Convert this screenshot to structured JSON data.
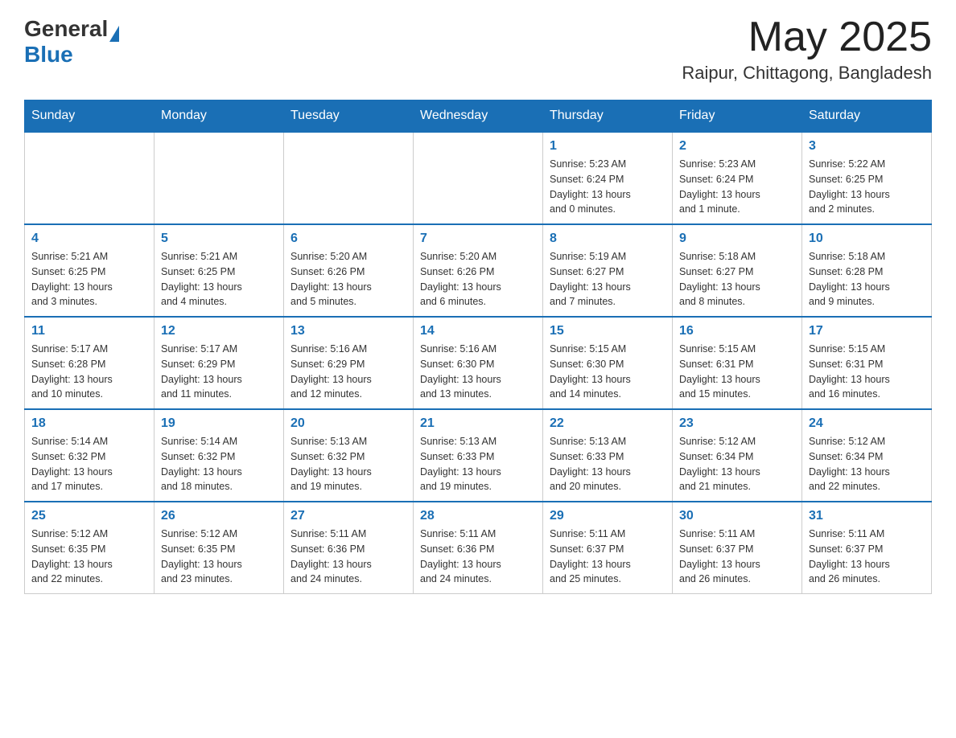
{
  "logo": {
    "general": "General",
    "blue": "Blue"
  },
  "title": "May 2025",
  "subtitle": "Raipur, Chittagong, Bangladesh",
  "days_of_week": [
    "Sunday",
    "Monday",
    "Tuesday",
    "Wednesday",
    "Thursday",
    "Friday",
    "Saturday"
  ],
  "weeks": [
    [
      {
        "day": "",
        "info": ""
      },
      {
        "day": "",
        "info": ""
      },
      {
        "day": "",
        "info": ""
      },
      {
        "day": "",
        "info": ""
      },
      {
        "day": "1",
        "info": "Sunrise: 5:23 AM\nSunset: 6:24 PM\nDaylight: 13 hours\nand 0 minutes."
      },
      {
        "day": "2",
        "info": "Sunrise: 5:23 AM\nSunset: 6:24 PM\nDaylight: 13 hours\nand 1 minute."
      },
      {
        "day": "3",
        "info": "Sunrise: 5:22 AM\nSunset: 6:25 PM\nDaylight: 13 hours\nand 2 minutes."
      }
    ],
    [
      {
        "day": "4",
        "info": "Sunrise: 5:21 AM\nSunset: 6:25 PM\nDaylight: 13 hours\nand 3 minutes."
      },
      {
        "day": "5",
        "info": "Sunrise: 5:21 AM\nSunset: 6:25 PM\nDaylight: 13 hours\nand 4 minutes."
      },
      {
        "day": "6",
        "info": "Sunrise: 5:20 AM\nSunset: 6:26 PM\nDaylight: 13 hours\nand 5 minutes."
      },
      {
        "day": "7",
        "info": "Sunrise: 5:20 AM\nSunset: 6:26 PM\nDaylight: 13 hours\nand 6 minutes."
      },
      {
        "day": "8",
        "info": "Sunrise: 5:19 AM\nSunset: 6:27 PM\nDaylight: 13 hours\nand 7 minutes."
      },
      {
        "day": "9",
        "info": "Sunrise: 5:18 AM\nSunset: 6:27 PM\nDaylight: 13 hours\nand 8 minutes."
      },
      {
        "day": "10",
        "info": "Sunrise: 5:18 AM\nSunset: 6:28 PM\nDaylight: 13 hours\nand 9 minutes."
      }
    ],
    [
      {
        "day": "11",
        "info": "Sunrise: 5:17 AM\nSunset: 6:28 PM\nDaylight: 13 hours\nand 10 minutes."
      },
      {
        "day": "12",
        "info": "Sunrise: 5:17 AM\nSunset: 6:29 PM\nDaylight: 13 hours\nand 11 minutes."
      },
      {
        "day": "13",
        "info": "Sunrise: 5:16 AM\nSunset: 6:29 PM\nDaylight: 13 hours\nand 12 minutes."
      },
      {
        "day": "14",
        "info": "Sunrise: 5:16 AM\nSunset: 6:30 PM\nDaylight: 13 hours\nand 13 minutes."
      },
      {
        "day": "15",
        "info": "Sunrise: 5:15 AM\nSunset: 6:30 PM\nDaylight: 13 hours\nand 14 minutes."
      },
      {
        "day": "16",
        "info": "Sunrise: 5:15 AM\nSunset: 6:31 PM\nDaylight: 13 hours\nand 15 minutes."
      },
      {
        "day": "17",
        "info": "Sunrise: 5:15 AM\nSunset: 6:31 PM\nDaylight: 13 hours\nand 16 minutes."
      }
    ],
    [
      {
        "day": "18",
        "info": "Sunrise: 5:14 AM\nSunset: 6:32 PM\nDaylight: 13 hours\nand 17 minutes."
      },
      {
        "day": "19",
        "info": "Sunrise: 5:14 AM\nSunset: 6:32 PM\nDaylight: 13 hours\nand 18 minutes."
      },
      {
        "day": "20",
        "info": "Sunrise: 5:13 AM\nSunset: 6:32 PM\nDaylight: 13 hours\nand 19 minutes."
      },
      {
        "day": "21",
        "info": "Sunrise: 5:13 AM\nSunset: 6:33 PM\nDaylight: 13 hours\nand 19 minutes."
      },
      {
        "day": "22",
        "info": "Sunrise: 5:13 AM\nSunset: 6:33 PM\nDaylight: 13 hours\nand 20 minutes."
      },
      {
        "day": "23",
        "info": "Sunrise: 5:12 AM\nSunset: 6:34 PM\nDaylight: 13 hours\nand 21 minutes."
      },
      {
        "day": "24",
        "info": "Sunrise: 5:12 AM\nSunset: 6:34 PM\nDaylight: 13 hours\nand 22 minutes."
      }
    ],
    [
      {
        "day": "25",
        "info": "Sunrise: 5:12 AM\nSunset: 6:35 PM\nDaylight: 13 hours\nand 22 minutes."
      },
      {
        "day": "26",
        "info": "Sunrise: 5:12 AM\nSunset: 6:35 PM\nDaylight: 13 hours\nand 23 minutes."
      },
      {
        "day": "27",
        "info": "Sunrise: 5:11 AM\nSunset: 6:36 PM\nDaylight: 13 hours\nand 24 minutes."
      },
      {
        "day": "28",
        "info": "Sunrise: 5:11 AM\nSunset: 6:36 PM\nDaylight: 13 hours\nand 24 minutes."
      },
      {
        "day": "29",
        "info": "Sunrise: 5:11 AM\nSunset: 6:37 PM\nDaylight: 13 hours\nand 25 minutes."
      },
      {
        "day": "30",
        "info": "Sunrise: 5:11 AM\nSunset: 6:37 PM\nDaylight: 13 hours\nand 26 minutes."
      },
      {
        "day": "31",
        "info": "Sunrise: 5:11 AM\nSunset: 6:37 PM\nDaylight: 13 hours\nand 26 minutes."
      }
    ]
  ]
}
